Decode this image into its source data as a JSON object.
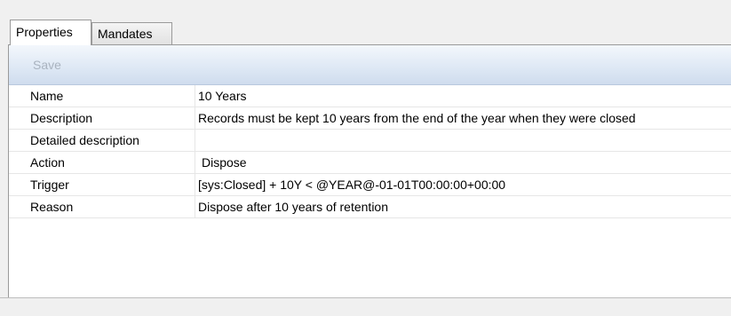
{
  "tabs": [
    {
      "label": "Properties",
      "active": true
    },
    {
      "label": "Mandates",
      "active": false
    }
  ],
  "toolbar": {
    "save_label": "Save"
  },
  "properties": [
    {
      "label": "Name",
      "value": "10 Years"
    },
    {
      "label": "Description",
      "value": "Records must be kept 10 years from the end of the year when they were closed"
    },
    {
      "label": "Detailed description",
      "value": ""
    },
    {
      "label": "Action",
      "value": "Dispose"
    },
    {
      "label": "Trigger",
      "value": "[sys:Closed] + 10Y < @YEAR@-01-01T00:00:00+00:00"
    },
    {
      "label": "Reason",
      "value": "Dispose after 10 years of retention"
    }
  ],
  "colors": {
    "toolbar_gradient_top": "#f3f7fc",
    "toolbar_gradient_bottom": "#cfdcee",
    "disabled_text": "#a9b3bf",
    "grid_line": "#e6e6e6"
  }
}
